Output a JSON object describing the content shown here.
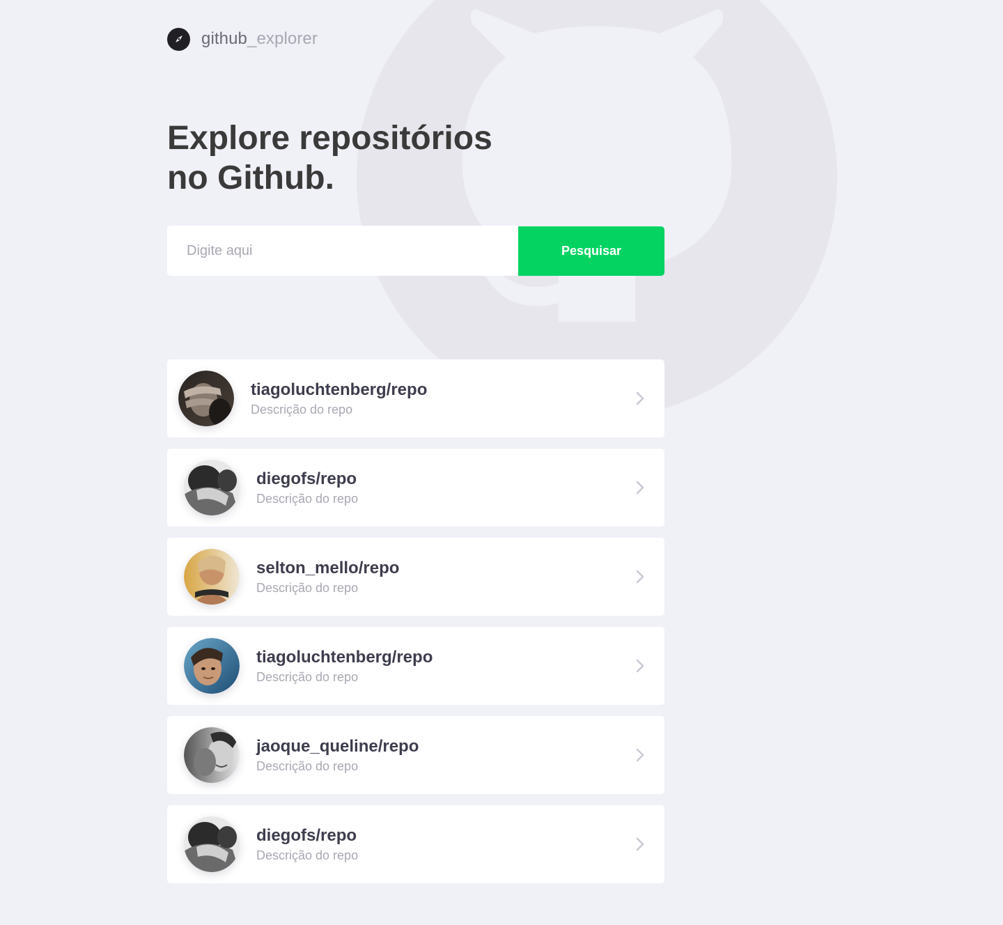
{
  "logo": {
    "text_bold": "github",
    "text_light": "_explorer",
    "icon": "compass-icon"
  },
  "title": {
    "line1": "Explore repositórios",
    "line2": "no Github."
  },
  "search": {
    "placeholder": "Digite aqui",
    "button_label": "Pesquisar"
  },
  "colors": {
    "background": "#f0f0f7",
    "accent": "#04d361",
    "title": "#3a3a3a",
    "muted": "#a8a8b3"
  },
  "repositories": [
    {
      "name": "tiagoluchtenberg/repo",
      "description": "Descrição do repo",
      "avatar": "avatar-photo-1"
    },
    {
      "name": "diegofs/repo",
      "description": "Descrição do repo",
      "avatar": "avatar-photo-2"
    },
    {
      "name": "selton_mello/repo",
      "description": "Descrição do repo",
      "avatar": "avatar-photo-3"
    },
    {
      "name": "tiagoluchtenberg/repo",
      "description": "Descrição do repo",
      "avatar": "avatar-photo-4"
    },
    {
      "name": "jaoque_queline/repo",
      "description": "Descrição do repo",
      "avatar": "avatar-photo-5"
    },
    {
      "name": "diegofs/repo",
      "description": "Descrição do repo",
      "avatar": "avatar-photo-6"
    }
  ]
}
